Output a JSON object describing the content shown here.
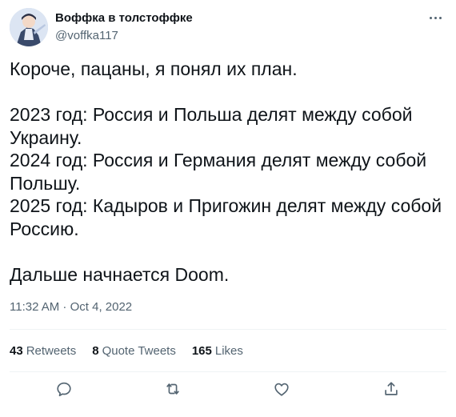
{
  "user": {
    "display_name": "Воффка в толстоффке",
    "handle": "@voffka117",
    "avatar_icon": "avatar-icon"
  },
  "tweet": {
    "text": "Короче, пацаны, я понял их план.\n\n2023 год: Россия и Польша делят между собой Украину.\n2024 год: Россия и Германия делят между собой Польшу.\n2025 год: Кадыров и Пригожин делят между собой Россию.\n\nДальше начнается Doom.",
    "timestamp": "11:32 AM · Oct 4, 2022"
  },
  "stats": {
    "retweets_count": "43",
    "retweets_label": "Retweets",
    "quotes_count": "8",
    "quotes_label": "Quote Tweets",
    "likes_count": "165",
    "likes_label": "Likes"
  },
  "actions": [
    "reply-icon",
    "retweet-icon",
    "like-icon",
    "share-icon"
  ],
  "colors": {
    "text_primary": "#0f1419",
    "text_secondary": "#536471",
    "divider": "#eff3f4"
  }
}
